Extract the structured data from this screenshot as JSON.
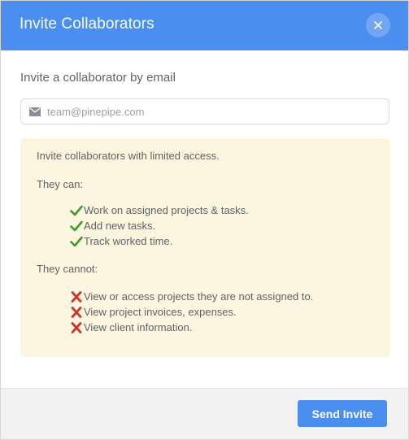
{
  "dialog": {
    "title": "Invite Collaborators",
    "close_icon": "close-icon"
  },
  "form": {
    "label": "Invite a collaborator by email",
    "email_placeholder": "team@pinepipe.com",
    "email_value": "",
    "mail_icon": "envelope-icon"
  },
  "info": {
    "intro": "Invite collaborators with limited access.",
    "can_heading": "They can:",
    "can_items": [
      "Work on assigned projects & tasks.",
      "Add new tasks.",
      "Track worked time."
    ],
    "cannot_heading": "They cannot:",
    "cannot_items": [
      "View or access projects they are not assigned to.",
      "View project invoices, expenses.",
      "View client information."
    ]
  },
  "footer": {
    "send_label": "Send Invite"
  },
  "colors": {
    "header_bg": "#4a8ef0",
    "button_bg": "#4a8ef0",
    "info_bg": "#fcf6e1",
    "check_green": "#3a9a2c",
    "cross_red": "#c8352a"
  }
}
